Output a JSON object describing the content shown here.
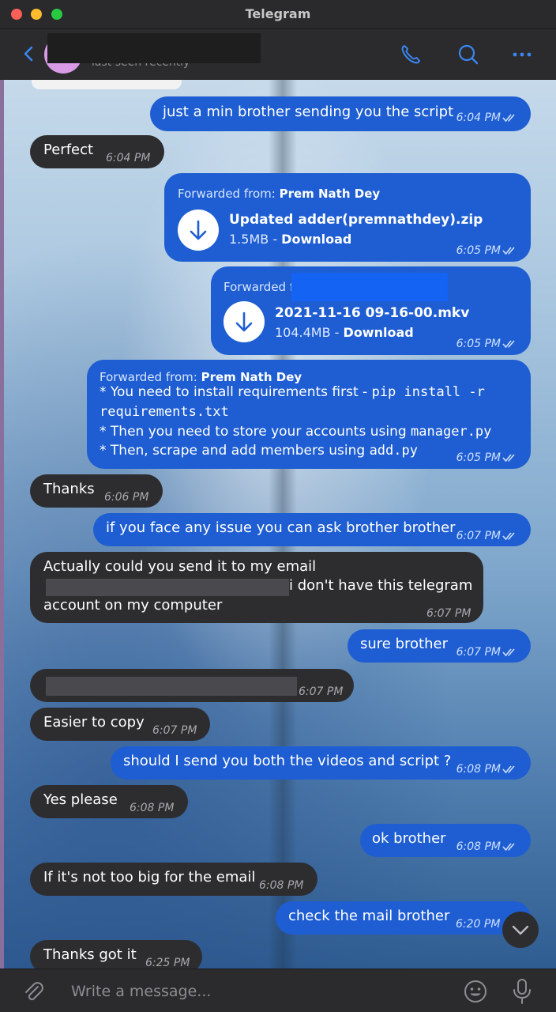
{
  "window": {
    "title": "Telegram"
  },
  "header": {
    "status": "last seen recently"
  },
  "messages": {
    "m1": {
      "text": "just a min brother sending you the script",
      "time": "6:04 PM"
    },
    "m2": {
      "text": "Perfect",
      "time": "6:04 PM"
    },
    "m3": {
      "fwd_label": "Forwarded from: ",
      "fwd_name": "Prem Nath Dey",
      "file_name": "Updated adder(premnathdey).zip",
      "file_size": "1.5MB - ",
      "download": "Download",
      "time": "6:05 PM"
    },
    "m4": {
      "fwd_label": "Forwarded f",
      "file_name": "2021-11-16 09-16-00.mkv",
      "file_size": "104.4MB - ",
      "download": "Download",
      "time": "6:05 PM"
    },
    "m5": {
      "fwd_label": "Forwarded from: ",
      "fwd_name": "Prem Nath Dey",
      "line1_text": "* You need to install requirements first - ",
      "line1_code": "pip install -r",
      "line2_code": "requirements.txt",
      "line3_text": "* Then you need to store your accounts using ",
      "line3_code": "manager.py",
      "line4_text": "* Then, scrape and add members using ",
      "line4_code": "add.py",
      "time": "6:05 PM"
    },
    "m6": {
      "text": "Thanks",
      "time": "6:06 PM"
    },
    "m7": {
      "text": "if you face any issue you can ask brother brother",
      "time": "6:07 PM"
    },
    "m8": {
      "line1": "Actually could you send it to my email",
      "line2": "i don't have this telegram",
      "line3": "account on my computer",
      "time": "6:07 PM"
    },
    "m9": {
      "text": "sure brother",
      "time": "6:07 PM"
    },
    "m10": {
      "time": "6:07 PM"
    },
    "m11": {
      "text": "Easier to copy",
      "time": "6:07 PM"
    },
    "m12": {
      "text": "should I send you both the videos and script ?",
      "time": "6:08 PM"
    },
    "m13": {
      "text": "Yes please",
      "time": "6:08 PM"
    },
    "m14": {
      "text": "ok brother",
      "time": "6:08 PM"
    },
    "m15": {
      "text": "If it's not too big for the email",
      "time": "6:08 PM"
    },
    "m16": {
      "text": "check the mail brother",
      "time": "6:20 PM"
    },
    "m17": {
      "text": "Thanks got it",
      "time": "6:25 PM"
    }
  },
  "composer": {
    "placeholder": "Write a message..."
  },
  "icons": {
    "back": "chevron-left-icon",
    "call": "phone-icon",
    "search": "search-icon",
    "more": "more-icon",
    "attach": "paperclip-icon",
    "emoji": "emoji-icon",
    "mic": "microphone-icon",
    "download": "download-icon",
    "scroll": "chevron-down-icon"
  },
  "colors": {
    "accent": "#3a86f0",
    "outgoing": "#1e5ed2",
    "incoming": "#2d2d30",
    "avatar": "#d99be6"
  }
}
